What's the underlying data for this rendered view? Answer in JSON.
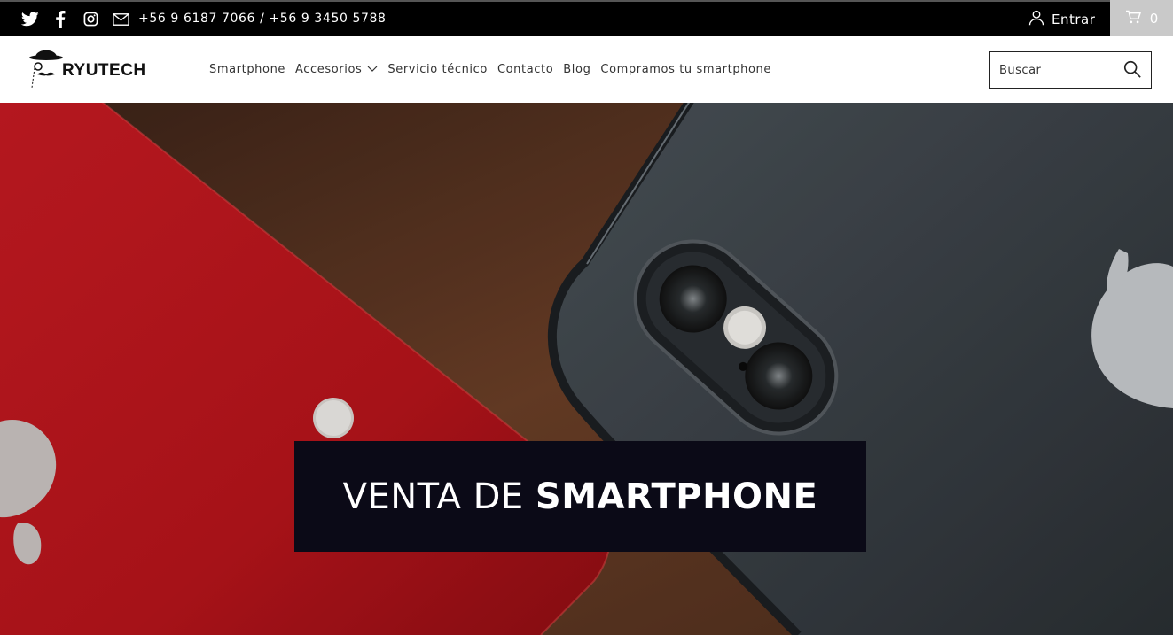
{
  "topbar": {
    "phone_text": "+56 9 6187 7066 / +56 9 3450 5788",
    "login_label": "Entrar",
    "cart_count": "0"
  },
  "header": {
    "logo_text": "RYUTECH",
    "nav": [
      {
        "label": "Smartphone"
      },
      {
        "label": "Accesorios"
      },
      {
        "label": "Servicio técnico"
      },
      {
        "label": "Contacto"
      },
      {
        "label": "Blog"
      },
      {
        "label": "Compramos tu smartphone"
      }
    ],
    "search_placeholder": "Buscar"
  },
  "hero": {
    "banner_light": "VENTA DE ",
    "banner_bold": "SMARTPHONE"
  },
  "icons": [
    "twitter-icon",
    "facebook-icon",
    "instagram-icon",
    "mail-icon",
    "user-icon",
    "cart-icon",
    "chevron-down-icon",
    "search-icon"
  ],
  "colors": {
    "topbar": "#000000",
    "cart_bg": "#c9c9c9",
    "banner_bg": "#0b0a17",
    "phone_red": "#b8141a",
    "phone_gray": "#3a4046"
  }
}
